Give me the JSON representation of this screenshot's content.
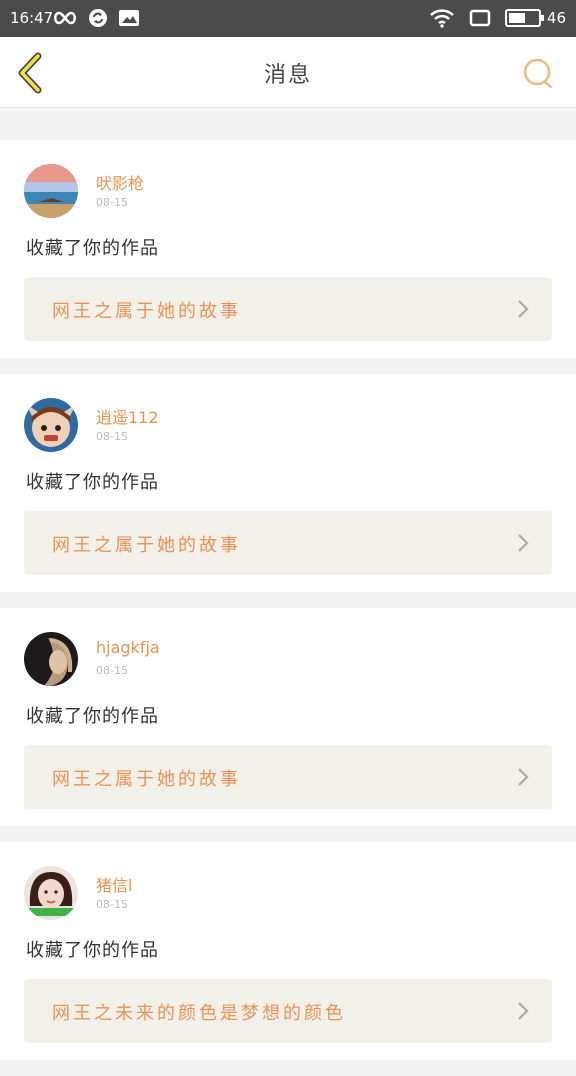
{
  "status_bar": {
    "time": "16:47",
    "battery": "46",
    "icons_left": [
      "infinity-icon",
      "sync-icon",
      "image-icon"
    ],
    "icons_right": [
      "wifi-icon",
      "screen-icon",
      "battery-icon"
    ]
  },
  "nav": {
    "title": "消息",
    "accent_color": "#f1b97a"
  },
  "messages": [
    {
      "username": "吠影枪",
      "date": "08-15",
      "action": "收藏了你的作品",
      "work_title": "网王之属于她的故事"
    },
    {
      "username": "逍遥112",
      "date": "08-15",
      "action": "收藏了你的作品",
      "work_title": "网王之属于她的故事"
    },
    {
      "username": "hjagkfja",
      "date": "08-15",
      "action": "收藏了你的作品",
      "work_title": "网王之属于她的故事"
    },
    {
      "username": "猪信l",
      "date": "08-15",
      "action": "收藏了你的作品",
      "work_title": "网王之未来的颜色是梦想的颜色"
    }
  ],
  "colors": {
    "username": "#e8944f",
    "work_title": "#ec9254",
    "work_bg": "#f1f1ea",
    "status_bar": "#4b4b4b"
  }
}
